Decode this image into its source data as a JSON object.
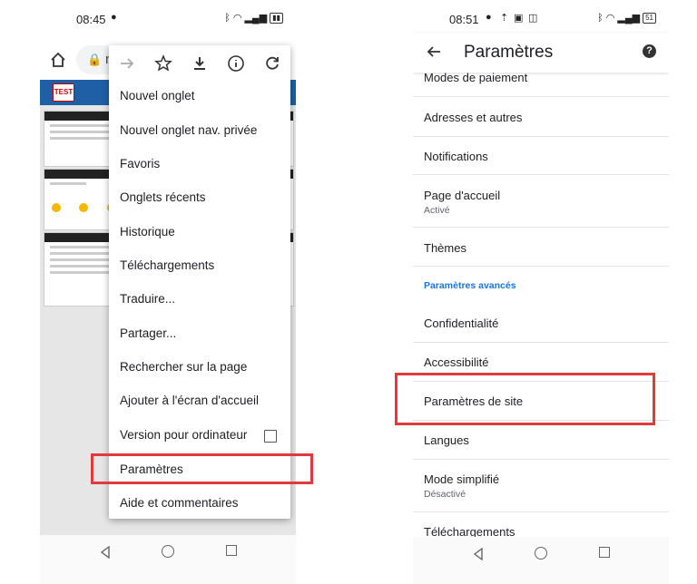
{
  "left_phone": {
    "status": {
      "time": "08:45"
    },
    "url_partial": "n",
    "web_logo": "TEST",
    "menu": {
      "items": [
        {
          "label": "Nouvel onglet"
        },
        {
          "label": "Nouvel onglet nav. privée"
        },
        {
          "label": "Favoris"
        },
        {
          "label": "Onglets récents"
        },
        {
          "label": "Historique"
        },
        {
          "label": "Téléchargements"
        },
        {
          "label": "Traduire..."
        },
        {
          "label": "Partager..."
        },
        {
          "label": "Rechercher sur la page"
        },
        {
          "label": "Ajouter à l'écran d'accueil"
        },
        {
          "label": "Version pour ordinateur"
        },
        {
          "label": "Paramètres"
        },
        {
          "label": "Aide et commentaires"
        }
      ]
    }
  },
  "right_phone": {
    "status": {
      "time": "08:51",
      "battery": "51"
    },
    "appbar": {
      "title": "Paramètres"
    },
    "settings": {
      "items": [
        {
          "label": "Modes de paiement"
        },
        {
          "label": "Adresses et autres"
        },
        {
          "label": "Notifications"
        },
        {
          "label": "Page d'accueil",
          "sub": "Activé"
        },
        {
          "label": "Thèmes"
        },
        {
          "section": "Paramètres avancés"
        },
        {
          "label": "Confidentialité"
        },
        {
          "label": "Accessibilité"
        },
        {
          "label": "Paramètres de site"
        },
        {
          "label": "Langues"
        },
        {
          "label": "Mode simplifié",
          "sub": "Désactivé"
        },
        {
          "label": "Téléchargements"
        }
      ]
    }
  },
  "colors": {
    "highlight": "#e0393e",
    "accent": "#1a73e8",
    "web_header": "#1f5fa6"
  }
}
